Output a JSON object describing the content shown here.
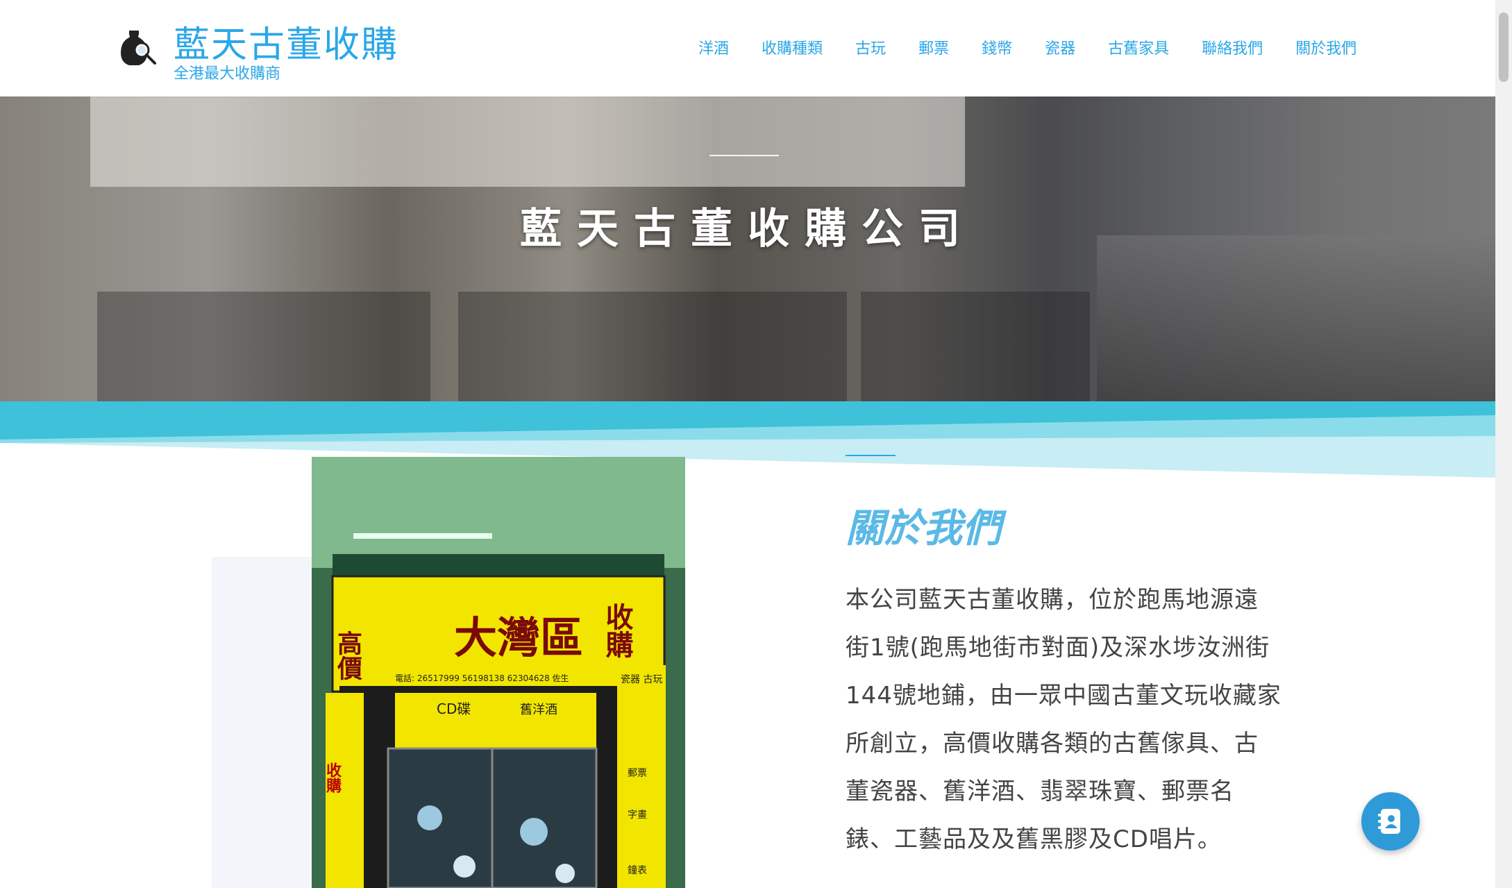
{
  "header": {
    "logo_icon": "vase-magnifier-icon",
    "title": "藍天古董收購",
    "tagline": "全港最大收購商",
    "nav": [
      {
        "label": "洋酒"
      },
      {
        "label": "收購種類"
      },
      {
        "label": "古玩"
      },
      {
        "label": "郵票"
      },
      {
        "label": "錢幣"
      },
      {
        "label": "瓷器"
      },
      {
        "label": "古舊家具"
      },
      {
        "label": "聯絡我們"
      },
      {
        "label": "關於我們"
      }
    ]
  },
  "hero": {
    "title": "藍天古董收購公司"
  },
  "about": {
    "title": "關於我們",
    "lines": [
      "本公司藍天古董收購，位於跑馬地源遠",
      "街1號(跑馬地街市對面)及深水埗汝洲街",
      "144號地鋪，由一眾中國古董文玩收藏家",
      "所創立，高價收購各類的古舊傢具、古",
      "董瓷器、舊洋酒、翡翠珠寶、郵票名",
      "錶、工藝品及及舊黑膠及CD唱片。"
    ]
  },
  "shop_photo": {
    "sign_main": "大灣區",
    "sign_side_left": "高價",
    "sign_side_right": "收購",
    "sign_phone": "電話: 26517999 56198138 62304628 佐生",
    "panel_cd": "CD碟",
    "panel_wine": "舊洋酒",
    "panel_left": "收購",
    "panel_right_top": "瓷器 古玩",
    "panel_right_stamps": "郵票",
    "panel_right_calligraphy": "字畫",
    "panel_right_watch": "鐘表"
  },
  "chat": {
    "icon": "contact-book-icon"
  },
  "colors": {
    "brand_blue": "#2aa7e8",
    "about_title": "#5bb9e6",
    "band_cyan": "#3ec1d9",
    "band_light": "#c8edf4",
    "chat_button": "#2f9ad8"
  }
}
